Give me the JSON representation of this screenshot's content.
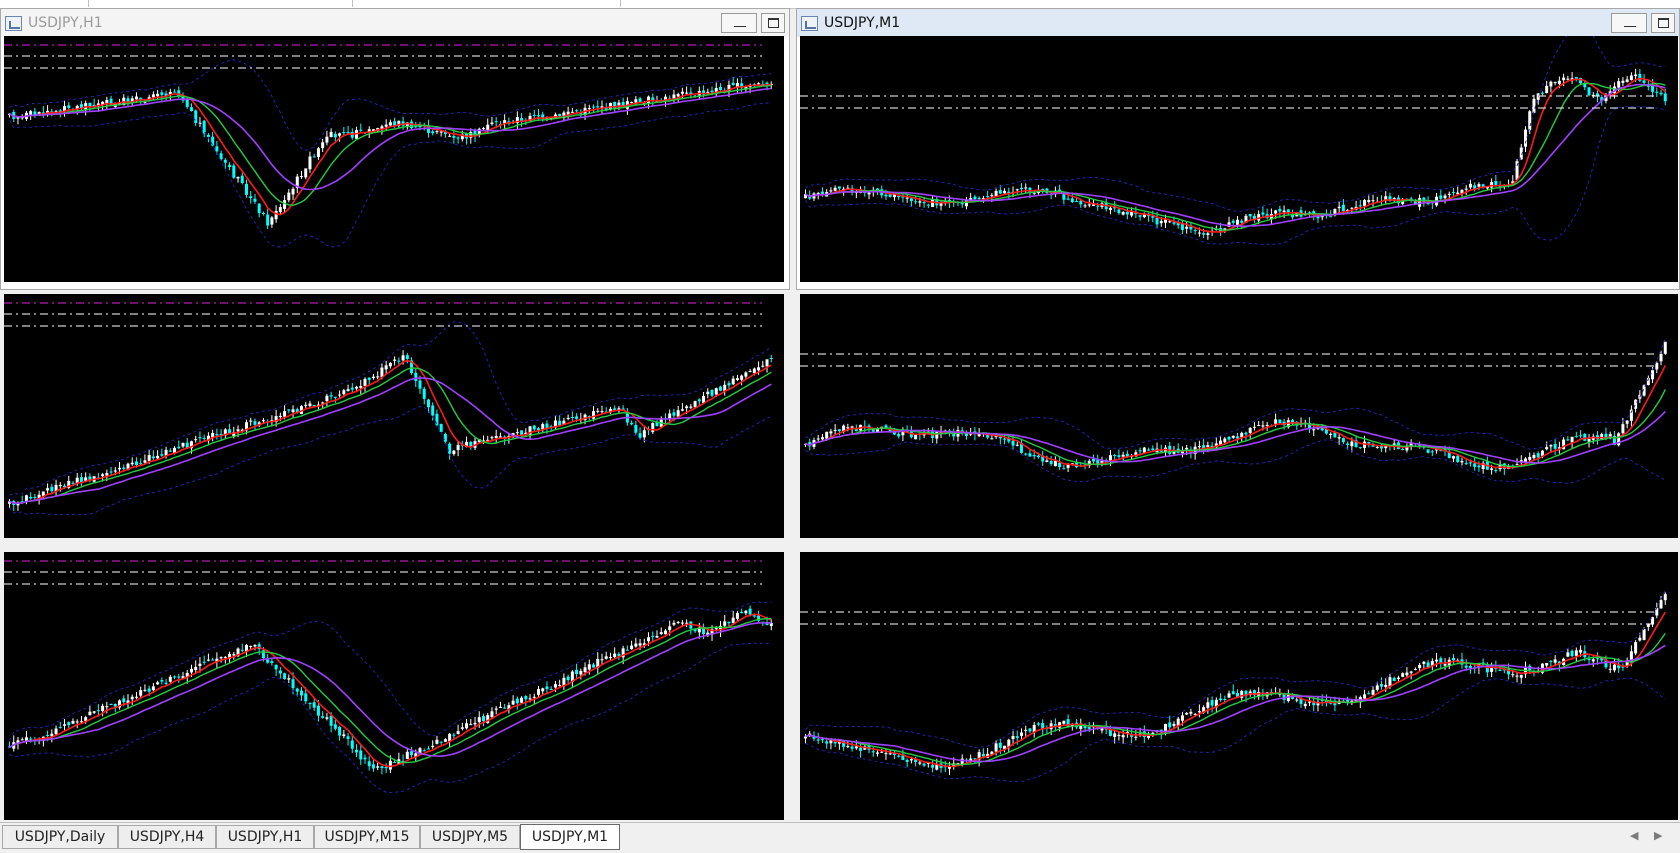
{
  "windows": [
    {
      "id": "w-h1",
      "title": "USDJPY,H1",
      "active": false,
      "trend": "v_recover"
    },
    {
      "id": "w-m1",
      "title": "USDJPY,M1",
      "active": true,
      "trend": "flat_spike"
    }
  ],
  "panes": [
    {
      "id": "h1",
      "trend": "v_recover"
    },
    {
      "id": "m1",
      "trend": "flat_spike"
    },
    {
      "id": "p3",
      "trend": "rise_dip"
    },
    {
      "id": "p4",
      "trend": "wave_spike"
    },
    {
      "id": "p5",
      "trend": "dip_rise"
    },
    {
      "id": "p6",
      "trend": "gentle_rise"
    }
  ],
  "tabs": [
    "USDJPY,Daily",
    "USDJPY,H4",
    "USDJPY,H1",
    "USDJPY,M15",
    "USDJPY,M5",
    "USDJPY,M1"
  ],
  "active_tab": 5,
  "colors": {
    "background": "#000000",
    "bull_candle": "#ffffff",
    "bear_candle": "#00ffff",
    "ma_fast": "#ff1a1a",
    "ma_mid": "#22cc44",
    "ma_slow": "#a040ff",
    "bollinger": "#2222aa",
    "level_magenta": "#e020e0",
    "level_white": "#ffffff"
  },
  "icons": {
    "scroll_left": "scroll-left-icon",
    "scroll_right": "scroll-right-icon",
    "window_icon": "chart-window-icon"
  }
}
